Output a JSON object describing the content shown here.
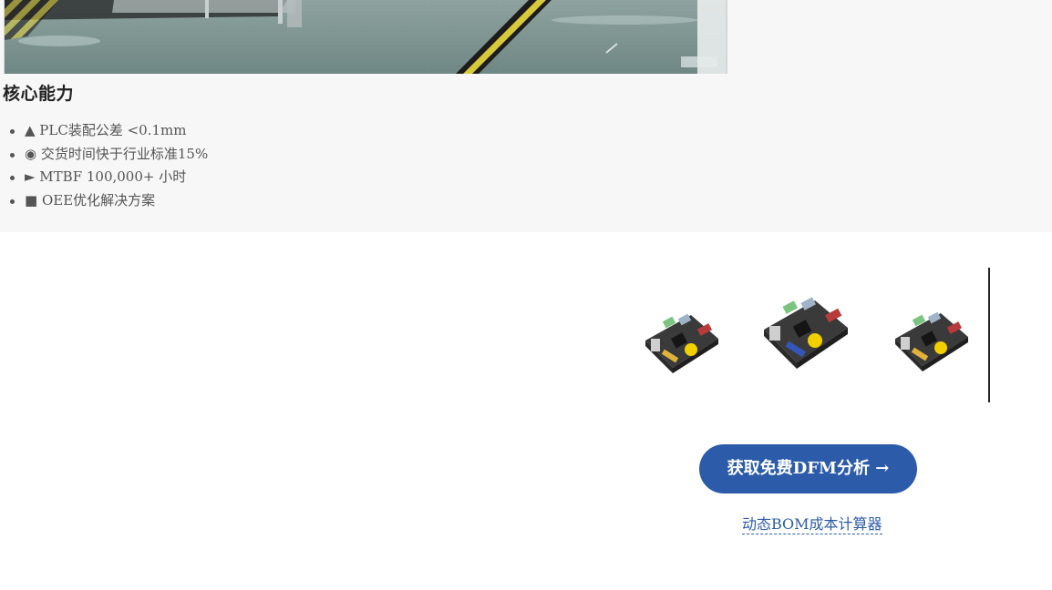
{
  "capabilities": {
    "heading": "核心能力",
    "items": [
      {
        "text": "▲ PLC装配公差 <0.1mm"
      },
      {
        "text": "◉ 交货时间快于行业标准15%"
      },
      {
        "text": "► MTBF 100,000+ 小时"
      },
      {
        "text": "■ OEE优化解决方案"
      }
    ]
  },
  "cta": {
    "primary_label": "获取免费DFM分析 →",
    "secondary_link": "动态BOM成本计算器"
  },
  "colors": {
    "accent": "#2c5ba9",
    "panel_bg": "#f7f7f7",
    "text_muted": "#555555"
  },
  "images": {
    "factory_photo": "factory-floor-photo",
    "products": [
      "circuit-board-photo",
      "circuit-board-photo",
      "circuit-board-photo"
    ]
  }
}
